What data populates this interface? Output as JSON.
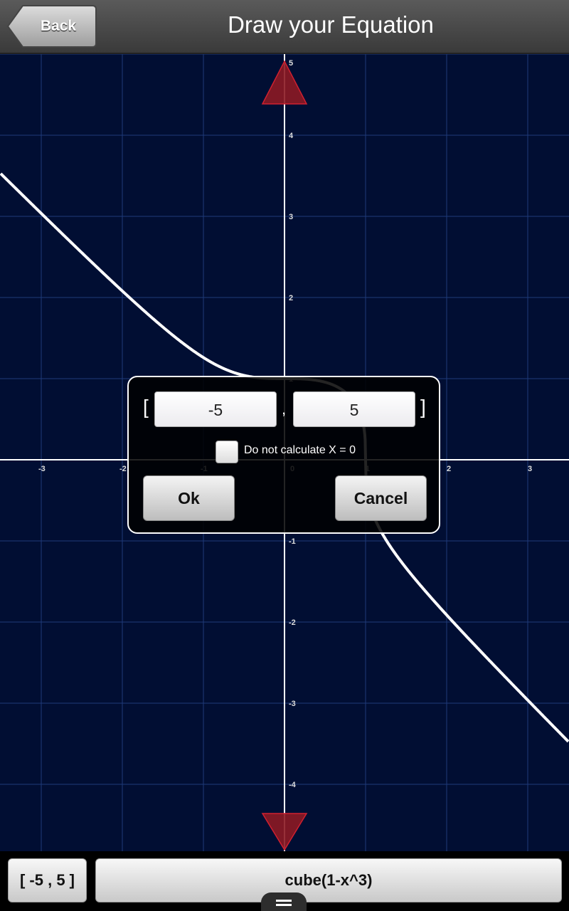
{
  "header": {
    "back_label": "Back",
    "title": "Draw your Equation"
  },
  "graph": {
    "x_ticks": [
      "-3",
      "-2",
      "-1",
      "0",
      "1",
      "2",
      "3"
    ],
    "y_ticks": [
      "5",
      "4",
      "3",
      "2",
      "1",
      "-1",
      "-2",
      "-3",
      "-4"
    ],
    "curve_color": "#ffffff",
    "grid_color": "#1e3a7a",
    "axis_color": "#ffffff",
    "marker_color": "#8c1a24",
    "markers": [
      "up-arrow-marker",
      "down-arrow-marker"
    ]
  },
  "chart_data": {
    "type": "line",
    "function": "cube(1-x^3)",
    "xlim": [
      -3.5,
      3.5
    ],
    "ylim": [
      -4.8,
      5.05
    ],
    "x_tick_labels": [
      "-3",
      "-2",
      "-1",
      "0",
      "1",
      "2",
      "3"
    ],
    "y_tick_labels": [
      "5",
      "4",
      "3",
      "2",
      "1",
      "-1",
      "-2",
      "-3",
      "-4"
    ],
    "grid": true,
    "series": [
      {
        "color": "#ffffff"
      }
    ]
  },
  "dialog": {
    "left_bracket": "[",
    "right_bracket": "]",
    "comma": ",",
    "min_value": "-5",
    "max_value": "5",
    "checkbox_label": "Do not calculate X = 0",
    "checkbox_checked": false,
    "ok_label": "Ok",
    "cancel_label": "Cancel"
  },
  "bottom": {
    "range_label": "[ -5 , 5 ]",
    "equation_label": "cube(1-x^3)"
  }
}
